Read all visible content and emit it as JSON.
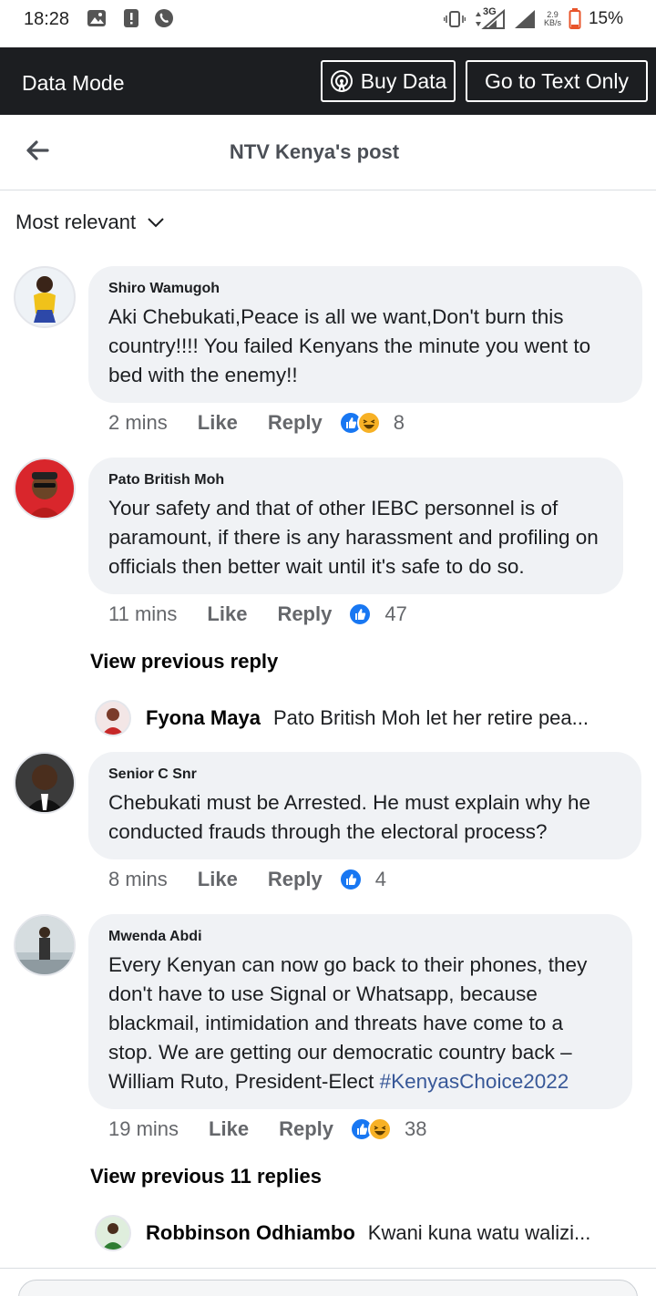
{
  "status_bar": {
    "time": "18:28",
    "network": "3G",
    "speed_value": "2.9",
    "speed_unit": "KB/s",
    "battery": "15%"
  },
  "data_bar": {
    "title": "Data Mode",
    "buy_label": "Buy Data",
    "text_only_label": "Go to Text Only"
  },
  "header": {
    "title": "NTV Kenya's post"
  },
  "sort": {
    "label": "Most relevant"
  },
  "comments": [
    {
      "name": "Shiro Wamugoh",
      "text": "Aki Chebukati,Peace is all we want,Don't burn this country!!!! You failed Kenyans the minute you went to bed with the enemy!!",
      "time": "2 mins",
      "like": "Like",
      "reply": "Reply",
      "reactions": [
        "like",
        "haha"
      ],
      "count": "8"
    },
    {
      "name": "Pato British Moh",
      "text": "Your safety and that of other IEBC personnel is of paramount, if there is any harassment and profiling on officials then better wait until it's safe to do so.",
      "time": "11 mins",
      "like": "Like",
      "reply": "Reply",
      "reactions": [
        "like"
      ],
      "count": "47",
      "view_previous": "View previous reply",
      "reply_preview": {
        "name": "Fyona Maya",
        "text": "Pato British Moh let her retire pea..."
      }
    },
    {
      "name": "Senior C Snr",
      "text": "Chebukati must be Arrested. He must explain why he conducted frauds through the electoral process?",
      "time": "8 mins",
      "like": "Like",
      "reply": "Reply",
      "reactions": [
        "like"
      ],
      "count": "4"
    },
    {
      "name": "Mwenda Abdi",
      "text": "Every Kenyan can now go back to their phones, they don't have to use Signal or Whatsapp, because blackmail, intimidation and threats have come to a stop. We are getting our democratic country back – William Ruto, President-Elect",
      "hashtag": "#KenyasChoice2022",
      "time": "19 mins",
      "like": "Like",
      "reply": "Reply",
      "reactions": [
        "like",
        "haha"
      ],
      "count": "38",
      "view_previous": "View previous 11 replies",
      "reply_preview": {
        "name": "Robbinson Odhiambo",
        "text": "Kwani kuna watu walizi..."
      }
    }
  ],
  "colors": {
    "data_bar_bg": "#1c1e21",
    "bubble_bg": "#f0f2f5",
    "like_blue": "#1877f2",
    "haha_yellow": "#f7b125",
    "hashtag": "#385898"
  }
}
